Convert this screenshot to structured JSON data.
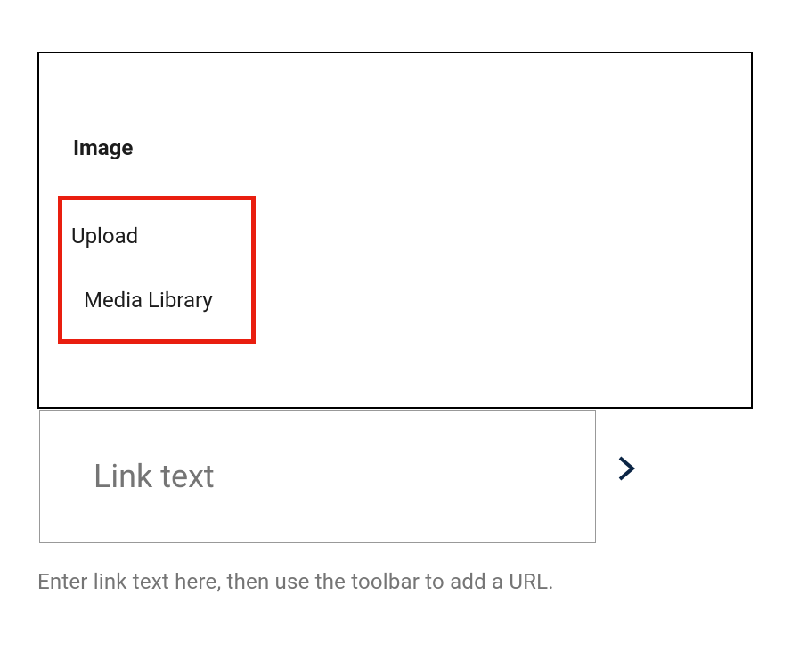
{
  "panel": {
    "title": "Image",
    "menu": {
      "upload": "Upload",
      "media_library": "Media Library"
    }
  },
  "link_input": {
    "placeholder": "Link text"
  },
  "helper_text": "Enter link text here, then use the toolbar to add a URL.",
  "colors": {
    "highlight": "#e91e0f",
    "text_primary": "#1c1c1c",
    "text_muted": "#757575"
  }
}
